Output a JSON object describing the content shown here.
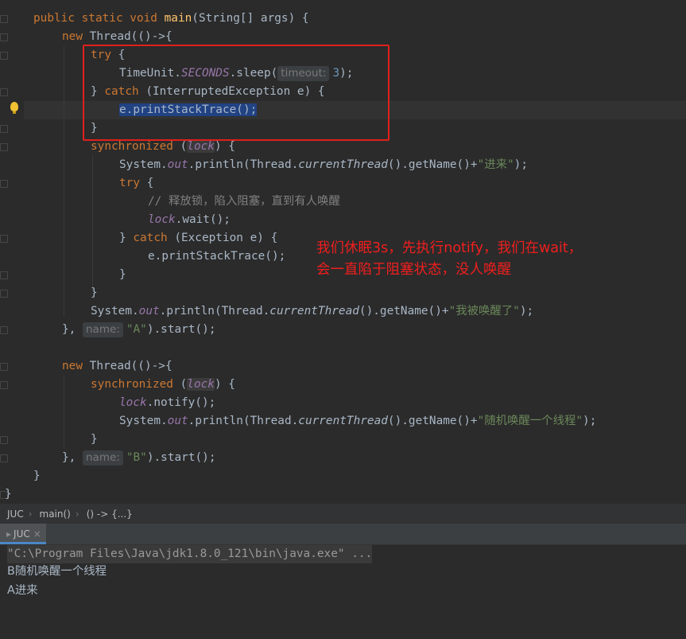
{
  "code": {
    "l1": {
      "kw1": "public static void",
      "fn": "main",
      "rest": "(String[] args) {"
    },
    "l2": {
      "kw": "new",
      "rest": " Thread(()->{"
    },
    "l3": {
      "kw": "try",
      "rest": " {"
    },
    "l4": {
      "a": "TimeUnit.",
      "static": "SECONDS",
      "b": ".sleep(",
      "hint": "timeout:",
      "num": "3",
      "c": ");"
    },
    "l5": {
      "a": "} ",
      "kw": "catch",
      "b": " (InterruptedException e) {"
    },
    "l6": {
      "sel": "e.printStackTrace();"
    },
    "l7": "}",
    "l8": {
      "kw": "synchronized",
      "a": " (",
      "lock": "lock",
      "b": ") {"
    },
    "l9": {
      "a": "System.",
      "out": "out",
      "b": ".println(Thread.",
      "ct": "currentThread",
      "c": "().getName()+",
      "str": "\"进来\"",
      "d": ");"
    },
    "l10": {
      "kw": "try",
      "rest": " {"
    },
    "l11": "// 释放锁，陷入阻塞，直到有人唤醒",
    "l12": {
      "lock": "lock",
      "rest": ".wait();"
    },
    "l13": {
      "a": "} ",
      "kw": "catch",
      "b": " (Exception e) {"
    },
    "l14": "e.printStackTrace();",
    "l15": "}",
    "l16": "}",
    "l17": {
      "a": "System.",
      "out": "out",
      "b": ".println(Thread.",
      "ct": "currentThread",
      "c": "().getName()+",
      "str": "\"我被唤醒了\"",
      "d": ");"
    },
    "l18": {
      "a": "}, ",
      "hint": "name:",
      "str": "\"A\"",
      "b": ").start();"
    },
    "l19": {
      "kw": "new",
      "rest": " Thread(()->{"
    },
    "l20": {
      "kw": "synchronized",
      "a": " (",
      "lock": "lock",
      "b": ") {"
    },
    "l21": {
      "lock": "lock",
      "rest": ".notify();"
    },
    "l22": {
      "a": "System.",
      "out": "out",
      "b": ".println(Thread.",
      "ct": "currentThread",
      "c": "().getName()+",
      "str": "\"随机唤醒一个线程\"",
      "d": ");"
    },
    "l23": "}",
    "l24": {
      "a": "}, ",
      "hint": "name:",
      "str": "\"B\"",
      "b": ").start();"
    },
    "l25": "}",
    "l26": "}"
  },
  "annotation": {
    "line1": "我们休眠3s，先执行notify，我们在wait，",
    "line2": "会一直陷于阻塞状态，没人唤醒"
  },
  "breadcrumb": [
    "JUC",
    "main()",
    "() -> {...}"
  ],
  "run_panel": {
    "tab_label": "JUC",
    "close": "×"
  },
  "console": {
    "cmd": "\"C:\\Program Files\\Java\\jdk1.8.0_121\\bin\\java.exe\" ...",
    "out1": "B随机唤醒一个线程",
    "out2": "A进来"
  }
}
